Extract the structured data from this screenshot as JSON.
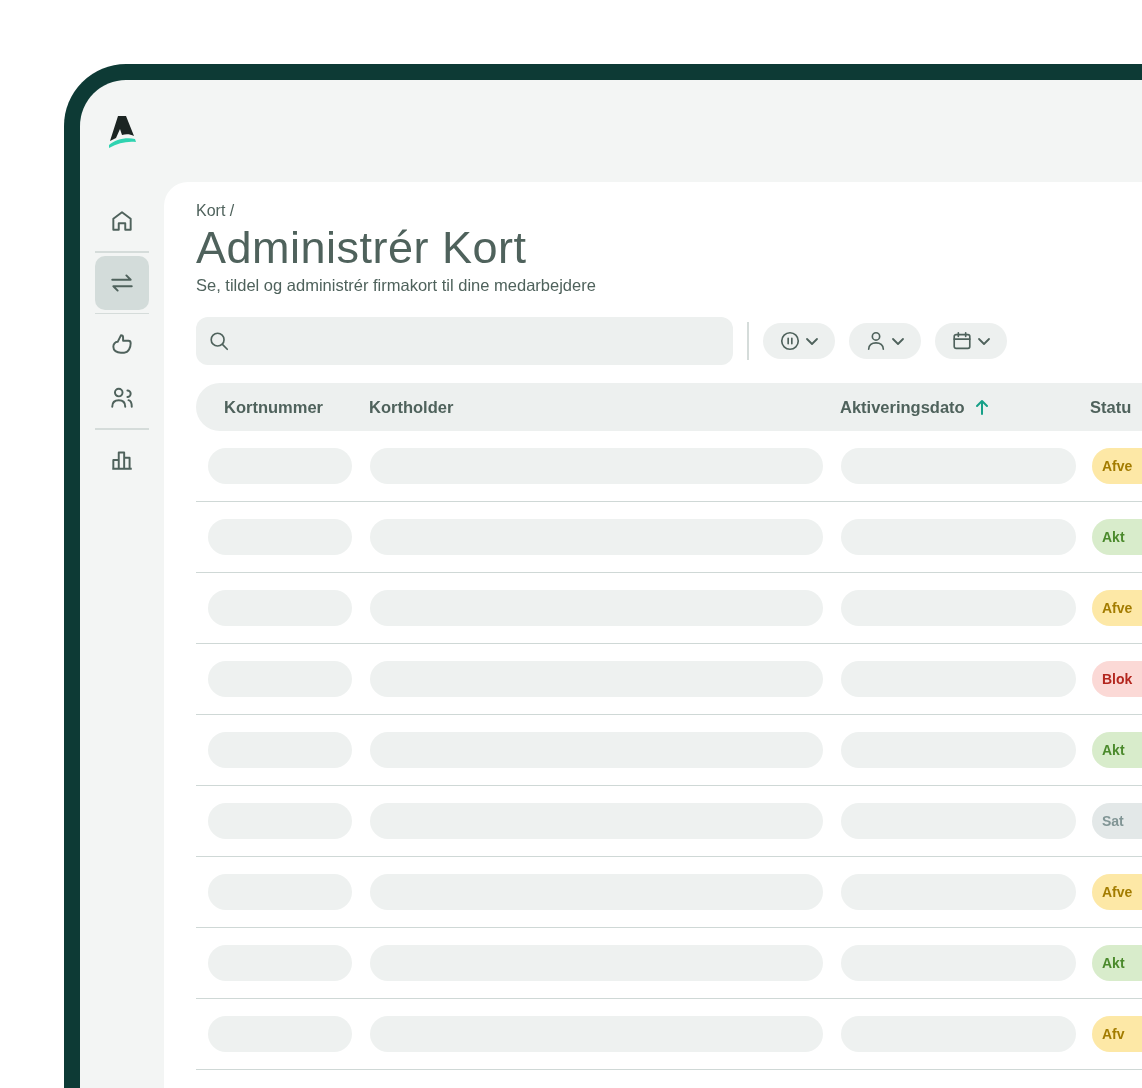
{
  "sidebar": {
    "items": [
      {
        "selected": false
      },
      {
        "selected": true
      },
      {
        "selected": false
      },
      {
        "selected": false
      },
      {
        "selected": false
      }
    ]
  },
  "breadcrumb": "Kort /",
  "title": "Administrér Kort",
  "subtitle": "Se, tildel og administrér firmakort til dine medarbejdere",
  "table": {
    "columns": [
      {
        "label": "Kortnummer",
        "sorted": false
      },
      {
        "label": "Kortholder",
        "sorted": false
      },
      {
        "label": "Aktiveringsdato",
        "sorted": true
      },
      {
        "label": "Statu",
        "sorted": false
      }
    ],
    "rows": [
      {
        "status": "Afve",
        "kind": "pending",
        "color": "#fde8a6"
      },
      {
        "status": "Akt",
        "kind": "active",
        "color": "#d8eccb"
      },
      {
        "status": "Afve",
        "kind": "pending",
        "color": "#fde8a6"
      },
      {
        "status": "Blok",
        "kind": "blocked",
        "color": "#fbd9d6"
      },
      {
        "status": "Akt",
        "kind": "active",
        "color": "#d8eccb"
      },
      {
        "status": "Sat",
        "kind": "paused",
        "color": "#e3e8e8"
      },
      {
        "status": "Afve",
        "kind": "pending",
        "color": "#fde8a6"
      },
      {
        "status": "Akt",
        "kind": "active",
        "color": "#d8eccb"
      },
      {
        "status": "Afv",
        "kind": "pending",
        "color": "#fde8a6"
      }
    ]
  }
}
